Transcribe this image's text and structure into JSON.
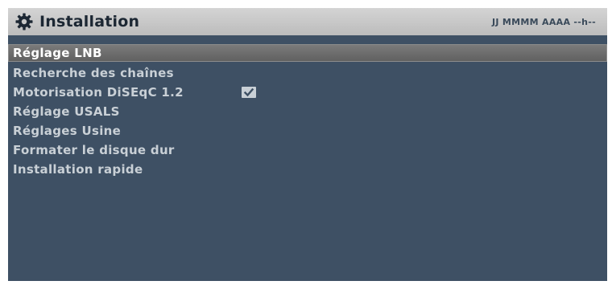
{
  "header": {
    "title": "Installation",
    "datetime": "JJ MMMM AAAA --h--",
    "icon": "gear-icon"
  },
  "menu": {
    "items": [
      {
        "label": "Réglage LNB",
        "selected": true
      },
      {
        "label": "Recherche des chaînes"
      },
      {
        "label": "Motorisation DiSEqC 1.2",
        "checked": true
      },
      {
        "label": "Réglage USALS"
      },
      {
        "label": "Réglages Usine"
      },
      {
        "label": "Formater le disque dur"
      },
      {
        "label": "Installation rapide"
      }
    ]
  },
  "colors": {
    "background": "#3e5064",
    "header": "#c8c8c8",
    "selection": "#6e6e6e",
    "text": "#c9d0d6",
    "selected_text": "#ffffff"
  }
}
